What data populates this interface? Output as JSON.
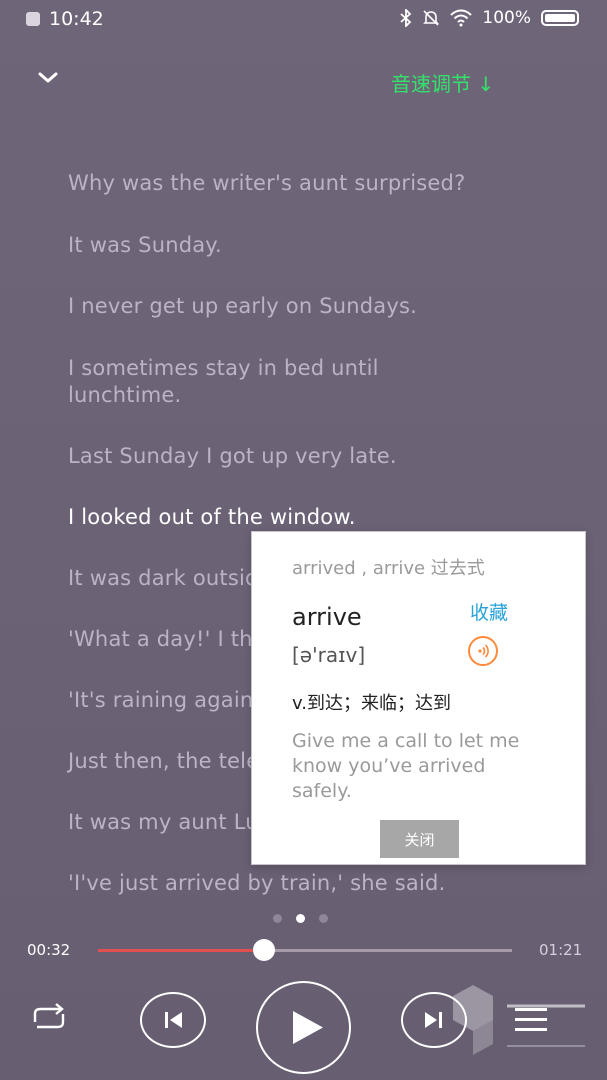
{
  "status_bar": {
    "time": "10:42",
    "battery": "100%"
  },
  "header": {
    "speed_label": "音速调节 ↓"
  },
  "lyrics": [
    {
      "text": "Why was the writer's aunt surprised?",
      "active": false
    },
    {
      "text": "It was Sunday.",
      "active": false
    },
    {
      "text": "I never get up early on Sundays.",
      "active": false
    },
    {
      "text": "I sometimes stay in bed until lunchtime.",
      "active": false
    },
    {
      "text": "Last Sunday I got up very late.",
      "active": false
    },
    {
      "text": "I looked out of the window.",
      "active": true
    },
    {
      "text": "It was dark outside.",
      "active": false
    },
    {
      "text": "'What a day!' I thought.",
      "active": false
    },
    {
      "text": "'It's raining again.'",
      "active": false
    },
    {
      "text": "Just then, the telephone rang.",
      "active": false
    },
    {
      "text": "It was my aunt Lucy.",
      "active": false
    },
    {
      "text": "'I've just arrived by train,' she said.",
      "active": false
    }
  ],
  "popup": {
    "word_form": "arrived , arrive 过去式",
    "word": "arrive",
    "favorite_label": "收藏",
    "phonetic": "[ə'raɪv]",
    "definition": "v.到达；来临；达到",
    "example": "Give me a call to let me know you’ve arrived safely.",
    "close_label": "关闭"
  },
  "pager": {
    "count": 3,
    "active_index": 1
  },
  "player": {
    "current_time": "00:32",
    "total_time": "01:21",
    "progress": 0.4
  },
  "colors": {
    "accent_speed": "#32e26b",
    "favorite": "#2aa3d8",
    "speaker": "#ff8a3c",
    "progress": "#e24f4f"
  }
}
